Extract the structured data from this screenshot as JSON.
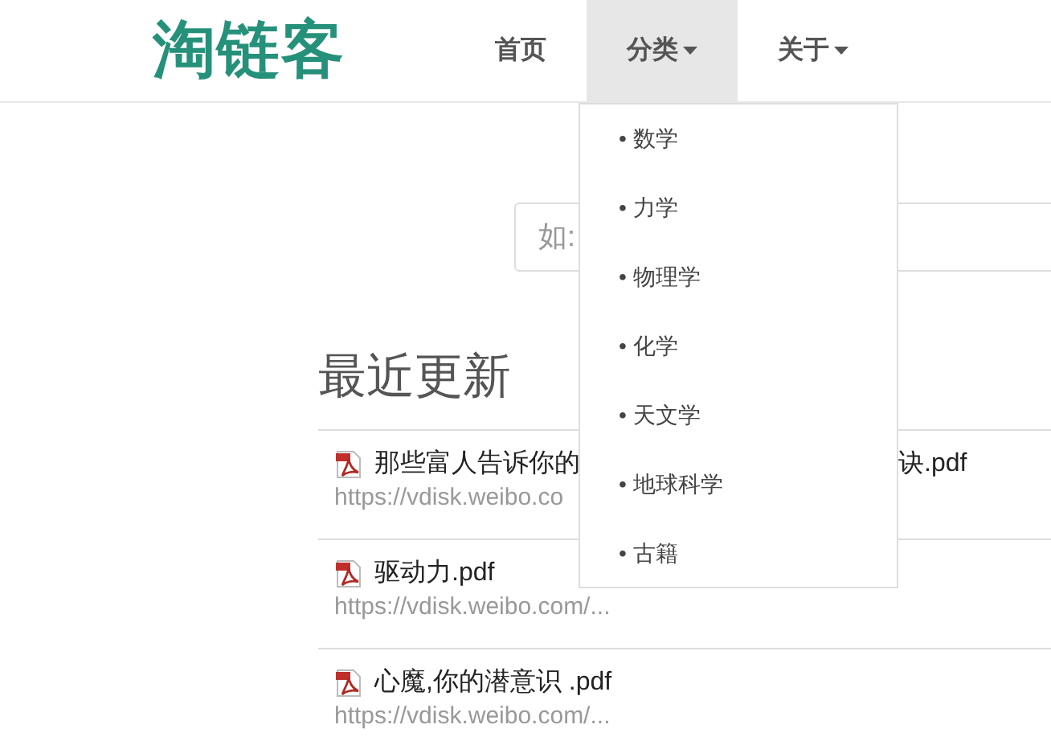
{
  "logo": "淘链客",
  "nav": [
    {
      "label": "首页",
      "dropdown": false,
      "selected": false
    },
    {
      "label": "分类",
      "dropdown": true,
      "selected": true
    },
    {
      "label": "关于",
      "dropdown": true,
      "selected": false
    }
  ],
  "category_menu": [
    "• 数学",
    "• 力学",
    "• 物理学",
    "• 化学",
    "• 天文学",
    "• 地球科学",
    "• 古籍"
  ],
  "search": {
    "placeholder": "如:"
  },
  "recent": {
    "heading": "最近更新",
    "items": [
      {
        "title_parts": [
          "那些富人告诉你的",
          "诀.pdf"
        ],
        "url": "https://vdisk.weibo.co"
      },
      {
        "title_parts": [
          "驱动力.pdf"
        ],
        "url": "https://vdisk.weibo.com/..."
      },
      {
        "title_parts": [
          "心魔,你的潜意识 .pdf"
        ],
        "url": "https://vdisk.weibo.com/..."
      }
    ]
  }
}
